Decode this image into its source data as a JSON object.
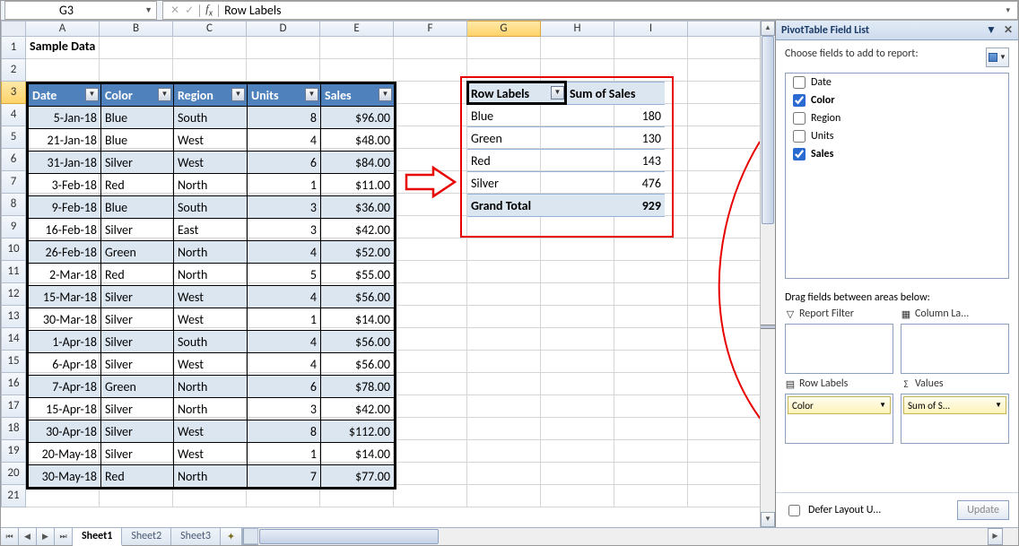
{
  "namebox": "G3",
  "formula": "Row Labels",
  "columns": [
    "A",
    "B",
    "C",
    "D",
    "E",
    "F",
    "G",
    "H",
    "I"
  ],
  "active_col_index": 6,
  "active_row": 3,
  "row_count": 21,
  "title_cell": "Sample Data",
  "table": {
    "headers": [
      "Date",
      "Color",
      "Region",
      "Units",
      "Sales"
    ],
    "rows": [
      {
        "date": "5-Jan-18",
        "color": "Blue",
        "region": "South",
        "units": 8,
        "sales": "$96.00"
      },
      {
        "date": "21-Jan-18",
        "color": "Blue",
        "region": "West",
        "units": 4,
        "sales": "$48.00"
      },
      {
        "date": "31-Jan-18",
        "color": "Silver",
        "region": "West",
        "units": 6,
        "sales": "$84.00"
      },
      {
        "date": "3-Feb-18",
        "color": "Red",
        "region": "North",
        "units": 1,
        "sales": "$11.00"
      },
      {
        "date": "9-Feb-18",
        "color": "Blue",
        "region": "South",
        "units": 3,
        "sales": "$36.00"
      },
      {
        "date": "16-Feb-18",
        "color": "Silver",
        "region": "East",
        "units": 3,
        "sales": "$42.00"
      },
      {
        "date": "26-Feb-18",
        "color": "Green",
        "region": "North",
        "units": 4,
        "sales": "$52.00"
      },
      {
        "date": "2-Mar-18",
        "color": "Red",
        "region": "North",
        "units": 5,
        "sales": "$55.00"
      },
      {
        "date": "15-Mar-18",
        "color": "Silver",
        "region": "West",
        "units": 4,
        "sales": "$56.00"
      },
      {
        "date": "30-Mar-18",
        "color": "Silver",
        "region": "West",
        "units": 1,
        "sales": "$14.00"
      },
      {
        "date": "1-Apr-18",
        "color": "Silver",
        "region": "South",
        "units": 4,
        "sales": "$56.00"
      },
      {
        "date": "6-Apr-18",
        "color": "Silver",
        "region": "West",
        "units": 4,
        "sales": "$56.00"
      },
      {
        "date": "7-Apr-18",
        "color": "Green",
        "region": "North",
        "units": 6,
        "sales": "$78.00"
      },
      {
        "date": "15-Apr-18",
        "color": "Silver",
        "region": "North",
        "units": 3,
        "sales": "$42.00"
      },
      {
        "date": "30-Apr-18",
        "color": "Silver",
        "region": "West",
        "units": 8,
        "sales": "$112.00"
      },
      {
        "date": "20-May-18",
        "color": "Silver",
        "region": "West",
        "units": 1,
        "sales": "$14.00"
      },
      {
        "date": "30-May-18",
        "color": "Red",
        "region": "North",
        "units": 7,
        "sales": "$77.00"
      }
    ]
  },
  "pivot": {
    "row_labels_hdr": "Row Labels",
    "sum_hdr": "Sum of Sales",
    "rows": [
      {
        "label": "Blue",
        "val": 180
      },
      {
        "label": "Green",
        "val": 130
      },
      {
        "label": "Red",
        "val": 143
      },
      {
        "label": "Silver",
        "val": 476
      }
    ],
    "grand_label": "Grand Total",
    "grand_val": 929
  },
  "pane": {
    "title": "PivotTable Field List",
    "choose": "Choose fields to add to report:",
    "fields": [
      {
        "name": "Date",
        "checked": false
      },
      {
        "name": "Color",
        "checked": true
      },
      {
        "name": "Region",
        "checked": false
      },
      {
        "name": "Units",
        "checked": false
      },
      {
        "name": "Sales",
        "checked": true
      }
    ],
    "drag_label": "Drag fields between areas below:",
    "areas": {
      "filter": "Report Filter",
      "columns": "Column La...",
      "rows": "Row Labels",
      "values": "Values"
    },
    "row_item": "Color",
    "val_item": "Sum of S...",
    "defer": "Defer Layout U...",
    "update": "Update"
  },
  "tabs": [
    "Sheet1",
    "Sheet2",
    "Sheet3"
  ],
  "active_tab": 0
}
